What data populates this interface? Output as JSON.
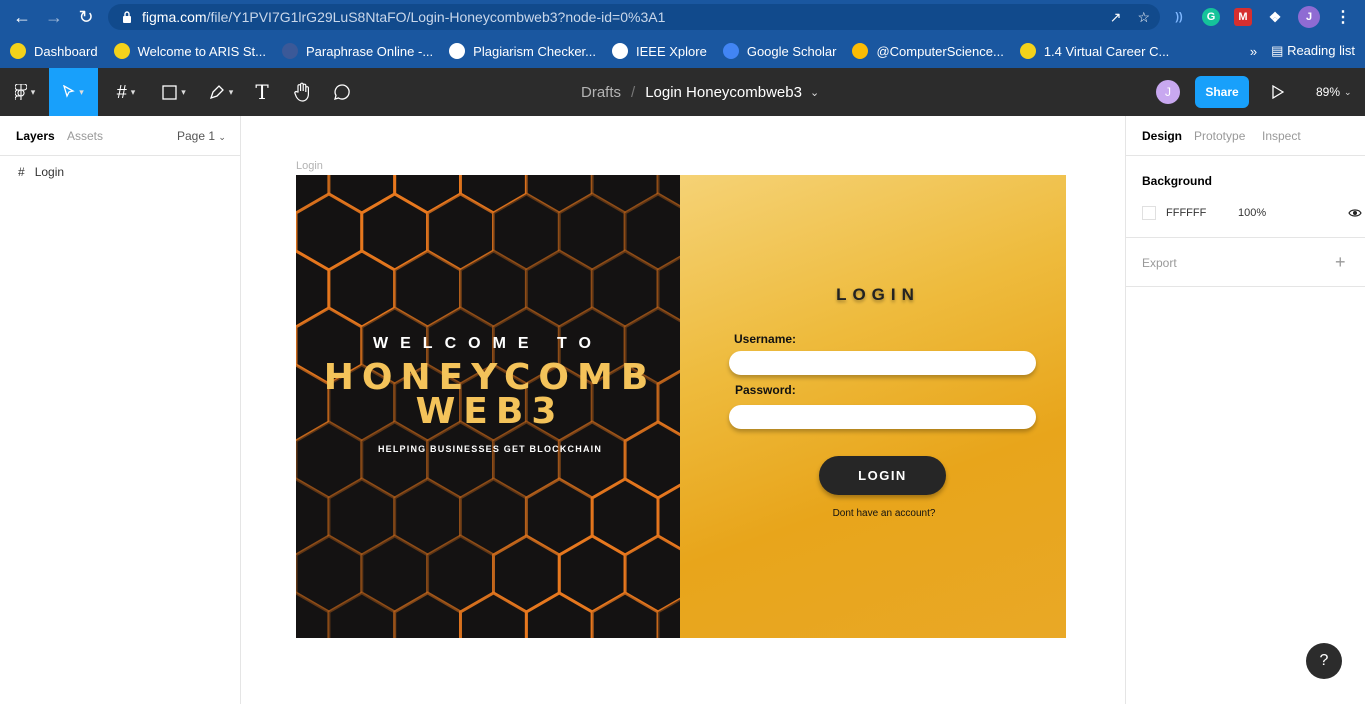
{
  "browser": {
    "url_host": "figma.com",
    "url_path": "/file/Y1PVI7G1lrG29LuS8NtaFO/Login-Honeycombweb3?node-id=0%3A1",
    "profile_initial": "J",
    "bookmarks": [
      {
        "label": "Dashboard",
        "icon": "tip-icon",
        "color": "#f3d21b"
      },
      {
        "label": "Welcome to ARIS St...",
        "icon": "aris-icon",
        "color": "#f3d21b"
      },
      {
        "label": "Paraphrase Online -...",
        "icon": "paraphrase-icon",
        "color": "#3b5998"
      },
      {
        "label": "Plagiarism Checker...",
        "icon": "sst-icon",
        "color": "#ffffff"
      },
      {
        "label": "IEEE Xplore",
        "icon": "ieee-icon",
        "color": "#ffffff"
      },
      {
        "label": "Google Scholar",
        "icon": "scholar-icon",
        "color": "#4285f4"
      },
      {
        "label": "@ComputerScience...",
        "icon": "drive-icon",
        "color": "#fbbc04"
      },
      {
        "label": "1.4 Virtual Career C...",
        "icon": "tip-icon",
        "color": "#f3d21b"
      }
    ],
    "reading_list": "Reading list"
  },
  "figma": {
    "breadcrumb_drafts": "Drafts",
    "breadcrumb_sep": "/",
    "file_name": "Login Honeycombweb3",
    "user_initial": "J",
    "share_label": "Share",
    "zoom": "89%",
    "left_tabs": {
      "layers": "Layers",
      "assets": "Assets",
      "page": "Page 1"
    },
    "layers": [
      {
        "name": "Login"
      }
    ],
    "right_tabs": {
      "design": "Design",
      "prototype": "Prototype",
      "inspect": "Inspect"
    },
    "background_title": "Background",
    "background_hex": "FFFFFF",
    "background_opacity": "100%",
    "export_title": "Export",
    "help": "?"
  },
  "design": {
    "frame_label": "Login",
    "welcome": "WELCOME TO",
    "brand_line1": "HONEYCOMB",
    "brand_line2": "WEB3",
    "tagline": "HELPING BUSINESSES GET BLOCKCHAIN",
    "login_heading": "LOGIN",
    "username_label": "Username:",
    "password_label": "Password:",
    "login_button": "LOGIN",
    "no_account": "Dont have an account?",
    "accent_color": "#f4c35a",
    "panel_color": "#e8a51b"
  }
}
